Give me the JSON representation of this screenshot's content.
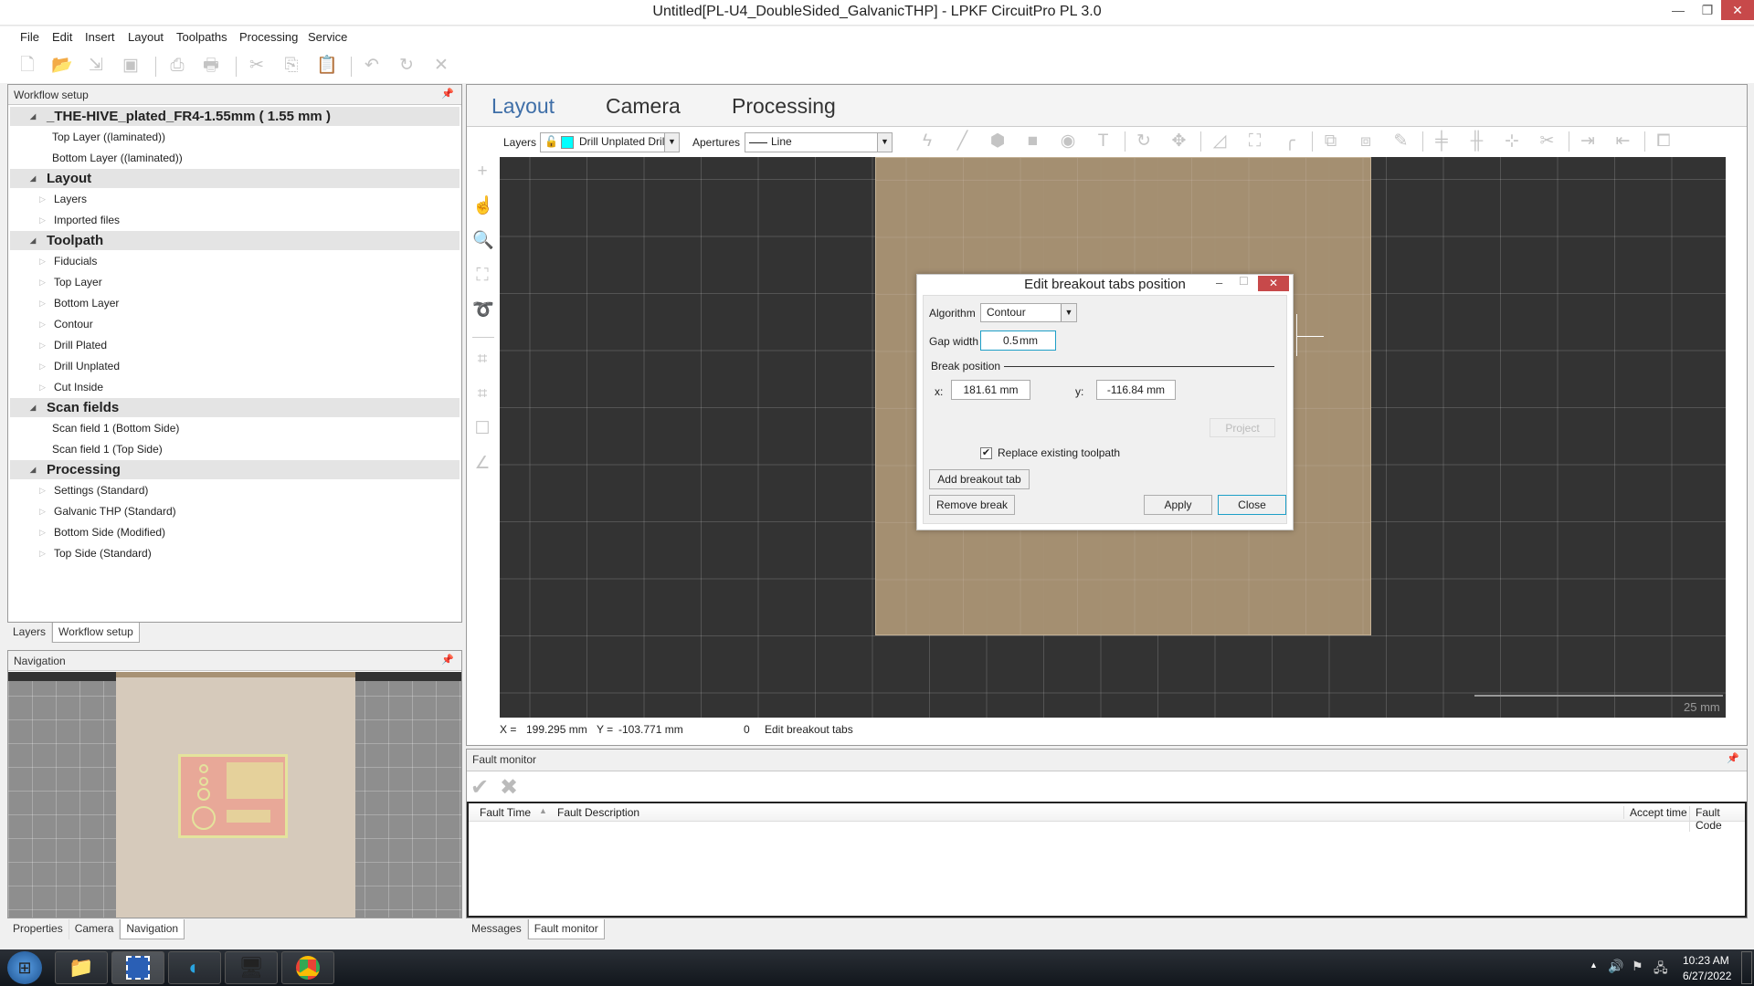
{
  "window": {
    "title": "Untitled[PL-U4_DoubleSided_GalvanicTHP] - LPKF CircuitPro PL 3.0"
  },
  "menu": [
    "File",
    "Edit",
    "Insert",
    "Layout",
    "Toolpaths",
    "Processing",
    "Service"
  ],
  "toolbar_icons": [
    "new-icon",
    "open-icon",
    "import-icon",
    "save-icon",
    "print-preview-icon",
    "print-icon",
    "cut-icon",
    "copy-icon",
    "paste-icon",
    "undo-icon",
    "redo-icon",
    "delete-icon"
  ],
  "workflow_panel": {
    "title": "Workflow setup",
    "material": {
      "label": "_THE-HIVE_plated_FR4-1.55mm ( 1.55 mm )",
      "items": [
        "Top Layer ((laminated))",
        "Bottom Layer ((laminated))"
      ]
    },
    "sections": [
      {
        "label": "Layout",
        "items": [
          "Layers",
          "Imported files"
        ]
      },
      {
        "label": "Toolpath",
        "items": [
          "Fiducials",
          "Top Layer",
          "Bottom Layer",
          "Contour",
          "Drill Plated",
          "Drill Unplated",
          "Cut Inside"
        ]
      },
      {
        "label": "Scan fields",
        "items": [
          "Scan field 1 (Bottom Side)",
          "Scan field 1 (Top Side)"
        ]
      },
      {
        "label": "Processing",
        "items": [
          "Settings (Standard)",
          "Galvanic THP (Standard)",
          "Bottom Side (Modified)",
          "Top Side (Standard)"
        ]
      }
    ],
    "tabs": [
      "Layers",
      "Workflow setup"
    ],
    "active_tab": "Workflow setup"
  },
  "navigation_panel": {
    "title": "Navigation",
    "tabs": [
      "Properties",
      "Camera",
      "Navigation"
    ],
    "active_tab": "Navigation"
  },
  "main_tabs": {
    "items": [
      "Layout",
      "Camera",
      "Processing"
    ],
    "active": "Layout"
  },
  "layer_toolbar": {
    "layers_label": "Layers",
    "layer_value": "Drill Unplated Dril",
    "layer_color": "#00ffff",
    "apertures_label": "Apertures",
    "aperture_value": "Line"
  },
  "canvas": {
    "scale_label": "25 mm",
    "board_color": "#a89274",
    "background": "#333333"
  },
  "status": {
    "x_label": "X =",
    "x_value": "199.295 mm",
    "y_label": "Y =",
    "y_value": "-103.771 mm",
    "count": "0",
    "mode": "Edit breakout tabs"
  },
  "dialog": {
    "title": "Edit breakout tabs position",
    "algorithm_label": "Algorithm",
    "algorithm_value": "Contour",
    "gap_label": "Gap width",
    "gap_value": "0.5",
    "gap_unit": "mm",
    "break_position_label": "Break position",
    "x_label": "x:",
    "x_value": "181.61 mm",
    "y_label": "y:",
    "y_value": "-116.84 mm",
    "project_label": "Project",
    "replace_label": "Replace existing toolpath",
    "replace_checked": true,
    "add_label": "Add breakout tab",
    "remove_label": "Remove break",
    "apply_label": "Apply",
    "close_label": "Close"
  },
  "fault_monitor": {
    "title": "Fault monitor",
    "columns": [
      "Fault Time",
      "Fault Description",
      "Accept time",
      "Fault Code"
    ],
    "rows": [],
    "tabs": [
      "Messages",
      "Fault monitor"
    ],
    "active_tab": "Fault monitor"
  },
  "taskbar": {
    "time": "10:23 AM",
    "date": "6/27/2022"
  }
}
